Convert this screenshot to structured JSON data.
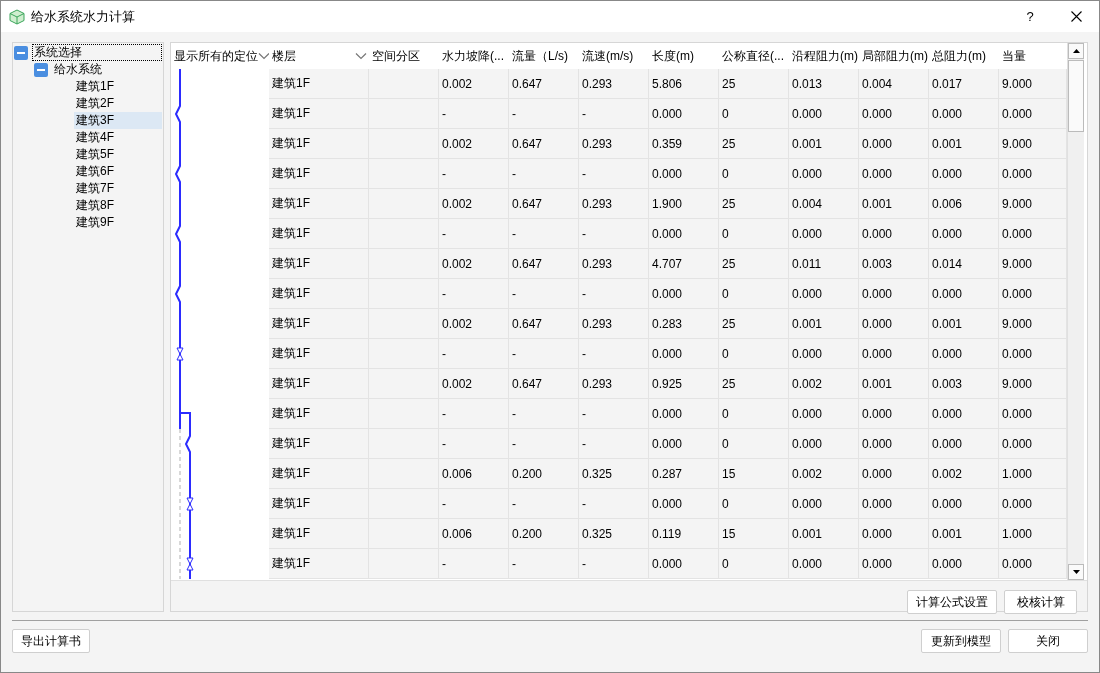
{
  "window": {
    "title": "给水系统水力计算",
    "help": "?"
  },
  "tree": [
    {
      "label": "系统选择",
      "expanded": true,
      "focused": true,
      "children": [
        {
          "label": "给水系统",
          "expanded": true,
          "children": [
            {
              "label": "建筑1F",
              "selected": false
            },
            {
              "label": "建筑2F",
              "selected": false
            },
            {
              "label": "建筑3F",
              "selected": true
            },
            {
              "label": "建筑4F",
              "selected": false
            },
            {
              "label": "建筑5F",
              "selected": false
            },
            {
              "label": "建筑6F",
              "selected": false
            },
            {
              "label": "建筑7F",
              "selected": false
            },
            {
              "label": "建筑8F",
              "selected": false
            },
            {
              "label": "建筑9F",
              "selected": false
            }
          ]
        }
      ]
    }
  ],
  "table": {
    "locator_column": {
      "label": "显示所有的定位",
      "dropdown": true
    },
    "columns": [
      {
        "label": "楼层",
        "dropdown": true
      },
      {
        "label": "空间分区",
        "dropdown": false
      },
      {
        "label": "水力坡降(...",
        "dropdown": false
      },
      {
        "label": "流量（L/s)",
        "dropdown": false
      },
      {
        "label": "流速(m/s)",
        "dropdown": false
      },
      {
        "label": "长度(m)",
        "dropdown": false
      },
      {
        "label": "公称直径(...",
        "dropdown": false
      },
      {
        "label": "沿程阻力(m)",
        "dropdown": false
      },
      {
        "label": "局部阻力(m)",
        "dropdown": false
      },
      {
        "label": "总阻力(m)",
        "dropdown": false
      },
      {
        "label": "当量",
        "dropdown": false
      }
    ],
    "rows": [
      {
        "cells": [
          "建筑1F",
          "",
          "0.002",
          "0.647",
          "0.293",
          "5.806",
          "25",
          "0.013",
          "0.004",
          "0.017",
          "9.000"
        ]
      },
      {
        "cells": [
          "建筑1F",
          "",
          "-",
          "-",
          "-",
          "0.000",
          "0",
          "0.000",
          "0.000",
          "0.000",
          "0.000"
        ]
      },
      {
        "cells": [
          "建筑1F",
          "",
          "0.002",
          "0.647",
          "0.293",
          "0.359",
          "25",
          "0.001",
          "0.000",
          "0.001",
          "9.000"
        ]
      },
      {
        "cells": [
          "建筑1F",
          "",
          "-",
          "-",
          "-",
          "0.000",
          "0",
          "0.000",
          "0.000",
          "0.000",
          "0.000"
        ]
      },
      {
        "cells": [
          "建筑1F",
          "",
          "0.002",
          "0.647",
          "0.293",
          "1.900",
          "25",
          "0.004",
          "0.001",
          "0.006",
          "9.000"
        ]
      },
      {
        "cells": [
          "建筑1F",
          "",
          "-",
          "-",
          "-",
          "0.000",
          "0",
          "0.000",
          "0.000",
          "0.000",
          "0.000"
        ]
      },
      {
        "cells": [
          "建筑1F",
          "",
          "0.002",
          "0.647",
          "0.293",
          "4.707",
          "25",
          "0.011",
          "0.003",
          "0.014",
          "9.000"
        ]
      },
      {
        "cells": [
          "建筑1F",
          "",
          "-",
          "-",
          "-",
          "0.000",
          "0",
          "0.000",
          "0.000",
          "0.000",
          "0.000"
        ]
      },
      {
        "cells": [
          "建筑1F",
          "",
          "0.002",
          "0.647",
          "0.293",
          "0.283",
          "25",
          "0.001",
          "0.000",
          "0.001",
          "9.000"
        ]
      },
      {
        "cells": [
          "建筑1F",
          "",
          "-",
          "-",
          "-",
          "0.000",
          "0",
          "0.000",
          "0.000",
          "0.000",
          "0.000"
        ]
      },
      {
        "cells": [
          "建筑1F",
          "",
          "0.002",
          "0.647",
          "0.293",
          "0.925",
          "25",
          "0.002",
          "0.001",
          "0.003",
          "9.000"
        ]
      },
      {
        "cells": [
          "建筑1F",
          "",
          "-",
          "-",
          "-",
          "0.000",
          "0",
          "0.000",
          "0.000",
          "0.000",
          "0.000"
        ]
      },
      {
        "cells": [
          "建筑1F",
          "",
          "-",
          "-",
          "-",
          "0.000",
          "0",
          "0.000",
          "0.000",
          "0.000",
          "0.000"
        ]
      },
      {
        "cells": [
          "建筑1F",
          "",
          "0.006",
          "0.200",
          "0.325",
          "0.287",
          "15",
          "0.002",
          "0.000",
          "0.002",
          "1.000"
        ]
      },
      {
        "cells": [
          "建筑1F",
          "",
          "-",
          "-",
          "-",
          "0.000",
          "0",
          "0.000",
          "0.000",
          "0.000",
          "0.000"
        ]
      },
      {
        "cells": [
          "建筑1F",
          "",
          "0.006",
          "0.200",
          "0.325",
          "0.119",
          "15",
          "0.001",
          "0.000",
          "0.001",
          "1.000"
        ]
      },
      {
        "cells": [
          "建筑1F",
          "",
          "-",
          "-",
          "-",
          "0.000",
          "0",
          "0.000",
          "0.000",
          "0.000",
          "0.000"
        ]
      }
    ]
  },
  "panel_buttons": [
    "计算公式设置",
    "校核计算"
  ],
  "footer": {
    "left_buttons": [
      "导出计算书"
    ],
    "right_buttons": [
      "更新到模型",
      "关闭"
    ]
  }
}
